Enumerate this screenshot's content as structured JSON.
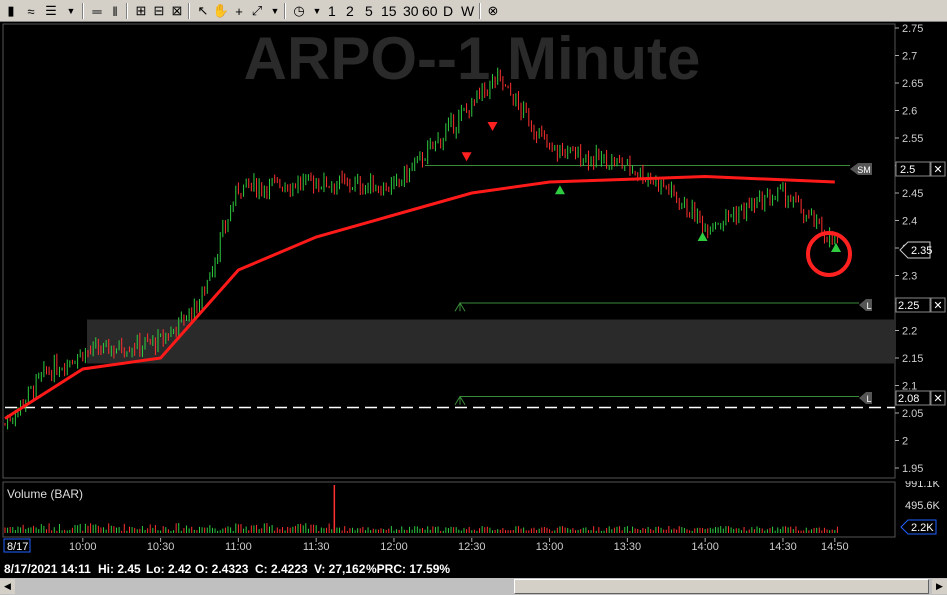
{
  "chart_title": "ARPO--1 Minute",
  "toolbar": {
    "intervals": [
      "1",
      "2",
      "5",
      "15",
      "30",
      "60",
      "D",
      "W"
    ]
  },
  "price_axis": {
    "ticks": [
      "2.75",
      "2.7",
      "2.65",
      "2.6",
      "2.55",
      "2.5",
      "2.45",
      "2.4",
      "2.35",
      "2.3",
      "2.25",
      "2.2",
      "2.15",
      "2.1",
      "2.05",
      "2",
      "1.95"
    ],
    "current_price": "2.35"
  },
  "lines": {
    "resistance_label": "2.5",
    "resistance_tag": "SM",
    "target1_label": "2.25",
    "target2_label": "2.08",
    "target_tag": "L"
  },
  "volume": {
    "title": "Volume (BAR)",
    "ticks": [
      "991.1K",
      "495.6K"
    ],
    "current": "2.2K"
  },
  "time_axis": {
    "date": "8/17",
    "labels": [
      "10:00",
      "10:30",
      "11:00",
      "11:30",
      "12:00",
      "12:30",
      "13:00",
      "13:30",
      "14:00",
      "14:30",
      "14:50"
    ]
  },
  "status": {
    "datetime": "8/17/2021 14:11",
    "hi": "Hi: 2.45",
    "lo": "Lo: 2.42",
    "open": "O: 2.4323",
    "close": "C: 2.4223",
    "volume": "V: 27,162",
    "prc": "%PRC: 17.59%"
  },
  "colors": {
    "candle_up": "#2ecc40",
    "candle_down": "#ff3030",
    "vwap": "#ff1a1a",
    "level_lines": "#3a8a3a",
    "zone": "#2a2a2a",
    "marker": "#ff2020"
  },
  "chart_data": {
    "type": "candlestick",
    "title": "ARPO--1 Minute",
    "ylim": [
      1.95,
      2.75
    ],
    "x_labels": [
      "8/17",
      "10:00",
      "10:30",
      "11:00",
      "11:30",
      "12:00",
      "12:30",
      "13:00",
      "13:30",
      "14:00",
      "14:30",
      "14:50"
    ],
    "approx_close_path": [
      {
        "time": "09:30",
        "price": 2.03
      },
      {
        "time": "09:45",
        "price": 2.12
      },
      {
        "time": "10:00",
        "price": 2.16
      },
      {
        "time": "10:30",
        "price": 2.18
      },
      {
        "time": "10:45",
        "price": 2.25
      },
      {
        "time": "11:00",
        "price": 2.46
      },
      {
        "time": "11:30",
        "price": 2.47
      },
      {
        "time": "12:00",
        "price": 2.46
      },
      {
        "time": "12:20",
        "price": 2.56
      },
      {
        "time": "12:40",
        "price": 2.66
      },
      {
        "time": "13:00",
        "price": 2.53
      },
      {
        "time": "13:30",
        "price": 2.5
      },
      {
        "time": "13:45",
        "price": 2.46
      },
      {
        "time": "14:00",
        "price": 2.39
      },
      {
        "time": "14:30",
        "price": 2.45
      },
      {
        "time": "14:50",
        "price": 2.36
      }
    ],
    "vwap_path": [
      {
        "time": "09:30",
        "price": 2.04
      },
      {
        "time": "10:00",
        "price": 2.13
      },
      {
        "time": "10:30",
        "price": 2.15
      },
      {
        "time": "11:00",
        "price": 2.31
      },
      {
        "time": "11:30",
        "price": 2.37
      },
      {
        "time": "12:00",
        "price": 2.41
      },
      {
        "time": "12:30",
        "price": 2.45
      },
      {
        "time": "13:00",
        "price": 2.47
      },
      {
        "time": "14:00",
        "price": 2.48
      },
      {
        "time": "14:50",
        "price": 2.47
      }
    ],
    "levels": [
      {
        "name": "resistance",
        "price": 2.5
      },
      {
        "name": "target1",
        "price": 2.25
      },
      {
        "name": "target2",
        "price": 2.08
      },
      {
        "name": "dashed",
        "price": 2.06
      }
    ],
    "zone": [
      2.14,
      2.22
    ]
  }
}
